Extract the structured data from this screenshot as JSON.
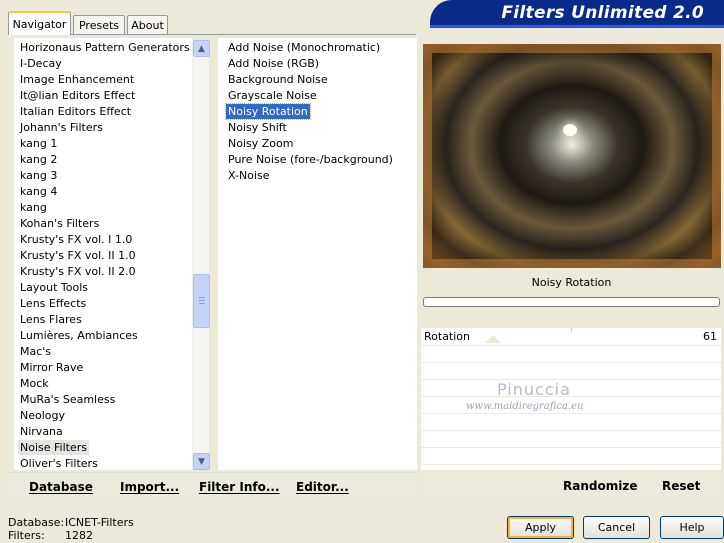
{
  "tabs": [
    {
      "label": "Navigator"
    },
    {
      "label": "Presets"
    },
    {
      "label": "About"
    }
  ],
  "banner_title": "Filters Unlimited 2.0",
  "categories": [
    "Horizonaus Pattern Generators",
    "I-Decay",
    "Image Enhancement",
    "It@lian Editors Effect",
    "Italian Editors Effect",
    "Johann's Filters",
    "kang 1",
    "kang 2",
    "kang 3",
    "kang 4",
    "kang",
    "Kohan's Filters",
    "Krusty's FX vol. I 1.0",
    "Krusty's FX vol. II 1.0",
    "Krusty's FX vol. II 2.0",
    "Layout Tools",
    "Lens Effects",
    "Lens Flares",
    "Lumières, Ambiances",
    "Mac's",
    "Mirror Rave",
    "Mock",
    "MuRa's Seamless",
    "Neology",
    "Nirvana",
    "Noise Filters",
    "Oliver's Filters"
  ],
  "selected_category": "Noise Filters",
  "filters": [
    "Add Noise (Monochromatic)",
    "Add Noise (RGB)",
    "Background Noise",
    "Grayscale Noise",
    "Noisy Rotation",
    "Noisy Shift",
    "Noisy Zoom",
    "Pure Noise (fore-/background)",
    "X-Noise"
  ],
  "selected_filter": "Noisy Rotation",
  "toolbar": {
    "database": "Database",
    "import": "Import...",
    "filter_info": "Filter Info...",
    "editor": "Editor...",
    "randomize": "Randomize",
    "reset": "Reset"
  },
  "filter_title": "Noisy Rotation",
  "params": [
    {
      "label": "Rotation",
      "value": "61"
    }
  ],
  "watermark": {
    "name": "Pinuccia",
    "url": "www.maidiregrafica.eu"
  },
  "status": {
    "database_label": "Database:",
    "database_value": "ICNET-Filters",
    "filters_label": "Filters:",
    "filters_value": "1282"
  },
  "buttons": {
    "apply": "Apply",
    "cancel": "Cancel",
    "help": "Help"
  },
  "colors": {
    "selection": "#316ac5",
    "banner": "#0a2a8a",
    "window_bg": "#ece9d8"
  }
}
